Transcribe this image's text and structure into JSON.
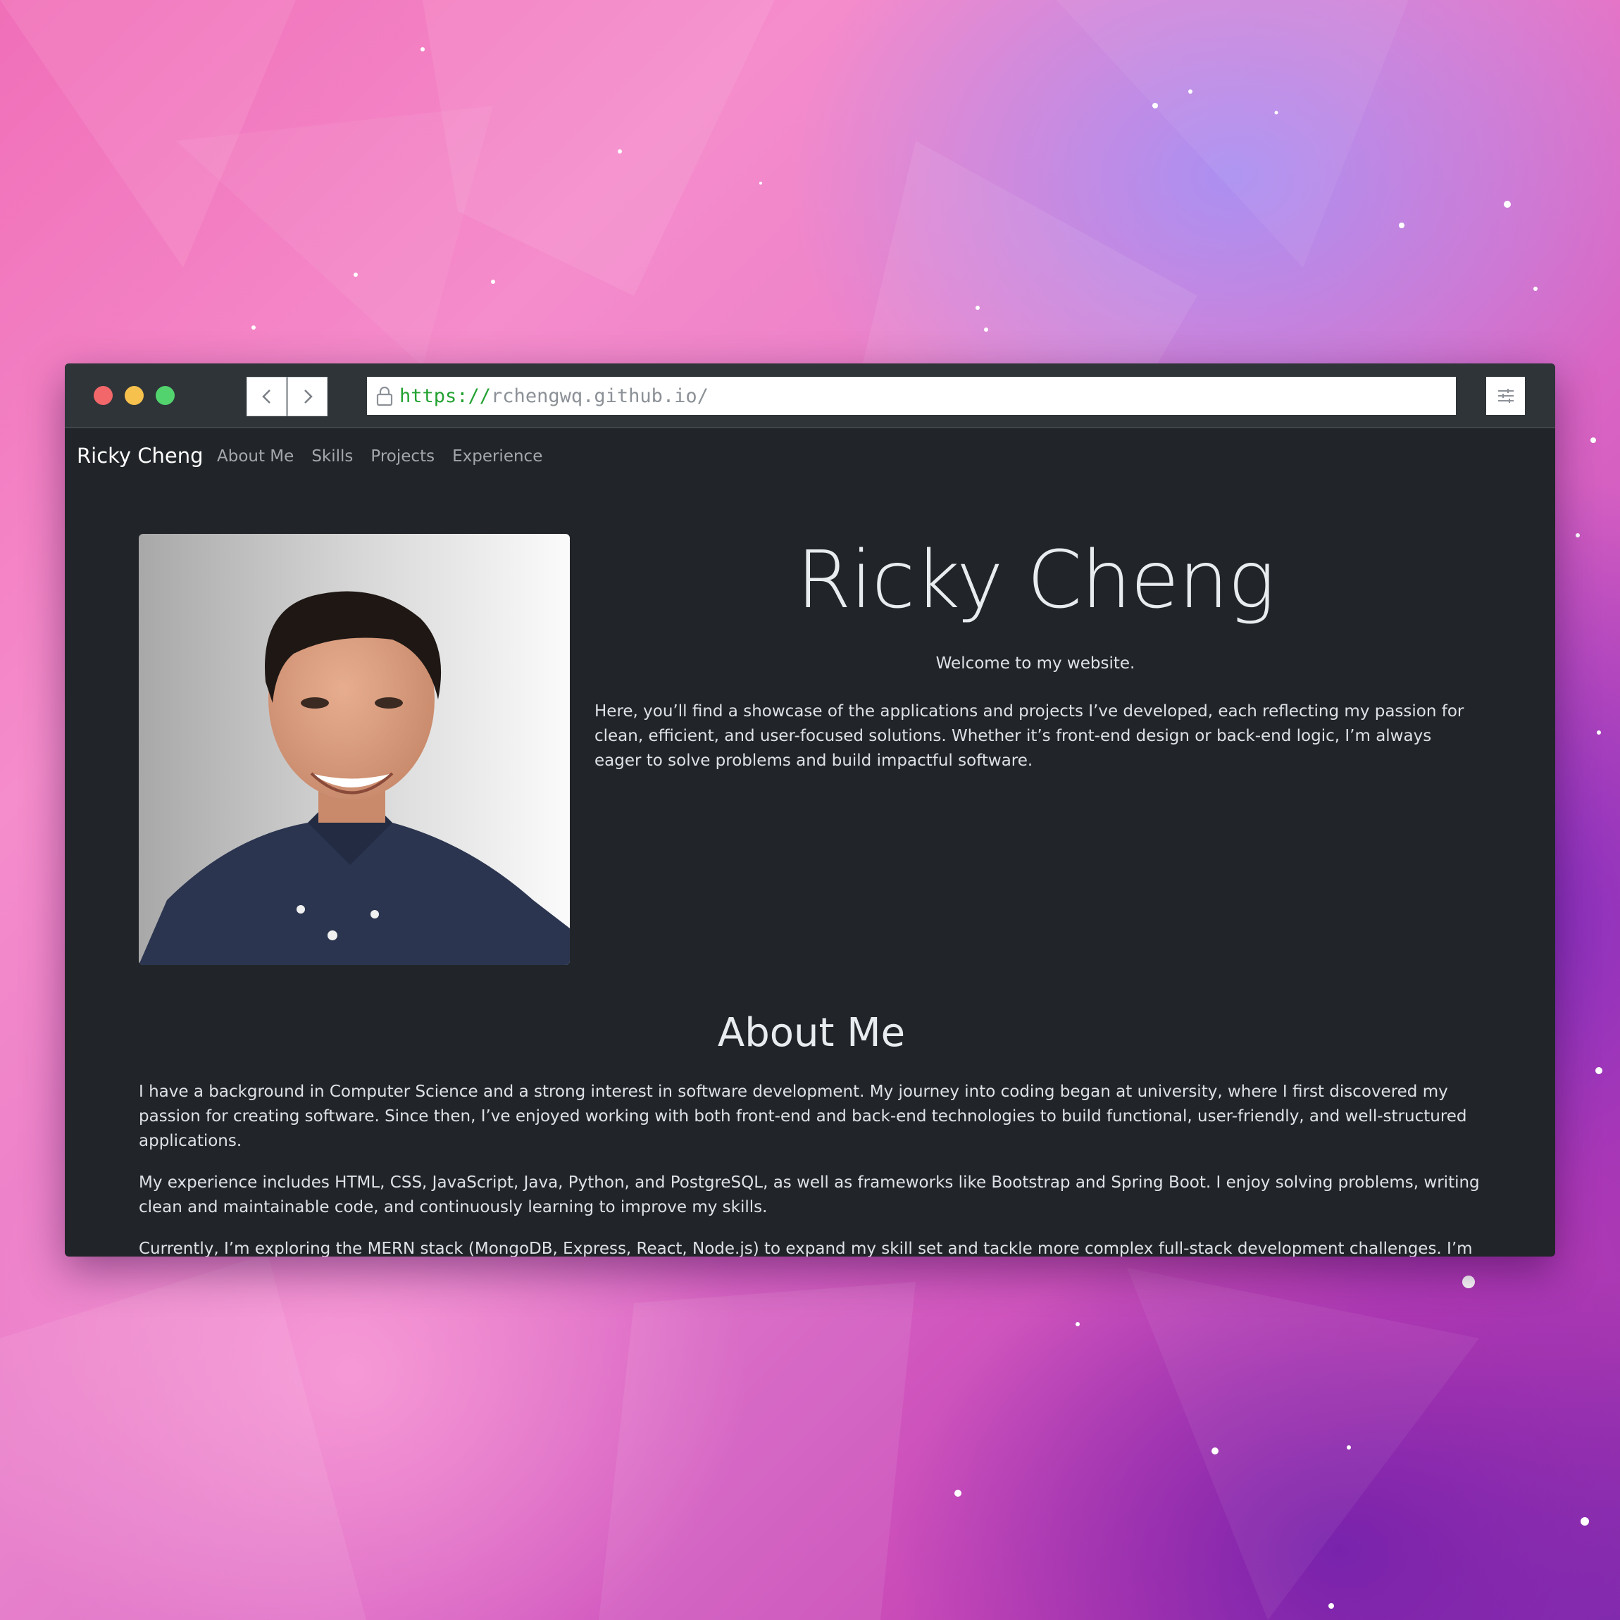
{
  "browser": {
    "url_scheme": "https://",
    "url_host": "rchengwq.github.io/"
  },
  "navbar": {
    "brand": "Ricky Cheng",
    "links": [
      "About Me",
      "Skills",
      "Projects",
      "Experience"
    ]
  },
  "hero": {
    "title": "Ricky Cheng",
    "subtitle": "Welcome to my website.",
    "body": "Here, you’ll find a showcase of the applications and projects I’ve developed, each reflecting my passion for clean, efficient, and user-focused solutions. Whether it’s front-end design or back-end logic, I’m always eager to solve problems and build impactful software."
  },
  "about": {
    "title": "About Me",
    "paragraphs": [
      "I have a background in Computer Science and a strong interest in software development. My journey into coding began at university, where I first discovered my passion for creating software. Since then, I’ve enjoyed working with both front-end and back-end technologies to build functional, user-friendly, and well-structured applications.",
      "My experience includes HTML, CSS, JavaScript, Java, Python, and PostgreSQL, as well as frameworks like Bootstrap and Spring Boot. I enjoy solving problems, writing clean and maintainable code, and continuously learning to improve my skills.",
      "Currently, I’m exploring the MERN stack (MongoDB, Express, React, Node.js) to expand my skill set and tackle more complex full-stack development challenges. I’m"
    ]
  },
  "icons": {
    "back": "chevron-left-icon",
    "forward": "chevron-right-icon",
    "lock": "lock-icon",
    "menu": "sliders-icon"
  },
  "colors": {
    "page_bg": "#212529",
    "chrome_bg": "#2f3438",
    "url_scheme": "#23a232",
    "traffic_red": "#f2676a",
    "traffic_yellow": "#f7c14e",
    "traffic_green": "#52d36e"
  }
}
